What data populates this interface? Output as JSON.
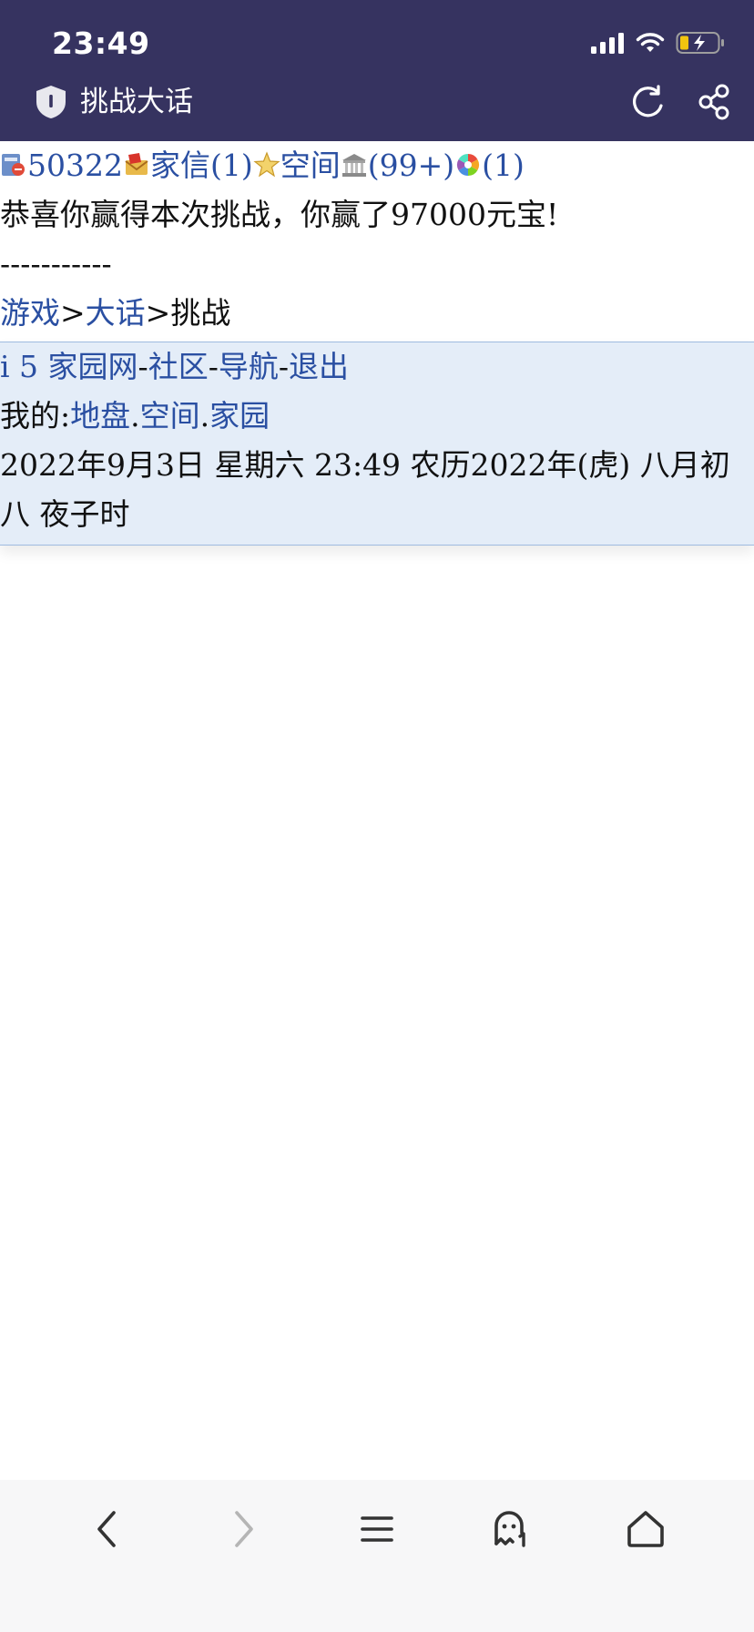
{
  "status_bar": {
    "time": "23:49"
  },
  "browser": {
    "page_title": "挑战大话"
  },
  "user_bar": {
    "user_id": "50322",
    "mail_label": "家信",
    "mail_count": "(1)",
    "space_label": "空间",
    "home_count": "(99+)",
    "color_count": "(1)"
  },
  "message": {
    "result": "恭喜你赢得本次挑战，你赢了97000元宝!",
    "divider": "-----------"
  },
  "breadcrumb": {
    "game": "游戏",
    "sep1": ">",
    "dahua": "大话",
    "sep2": ">",
    "current": "挑战"
  },
  "footer": {
    "site": "i 5 家园网",
    "sep1": "-",
    "community": "社区",
    "sep2": "-",
    "nav": "导航",
    "sep3": "-",
    "logout": "退出",
    "mine_label": "我的:",
    "territory": "地盘",
    "dot1": ".",
    "space": "空间",
    "dot2": ".",
    "homeland": "家园",
    "date_line": "2022年9月3日  星期六  23:49  农历2022年(虎)  八月初八  夜子时"
  },
  "colors": {
    "top_bar": "#363360",
    "link": "#2a4fa2",
    "footer_bg": "#e4edf8"
  },
  "icons": {
    "user": "user-card-icon",
    "mail": "mail-icon",
    "space": "star-icon",
    "home": "building-icon",
    "color": "color-wheel-icon"
  }
}
